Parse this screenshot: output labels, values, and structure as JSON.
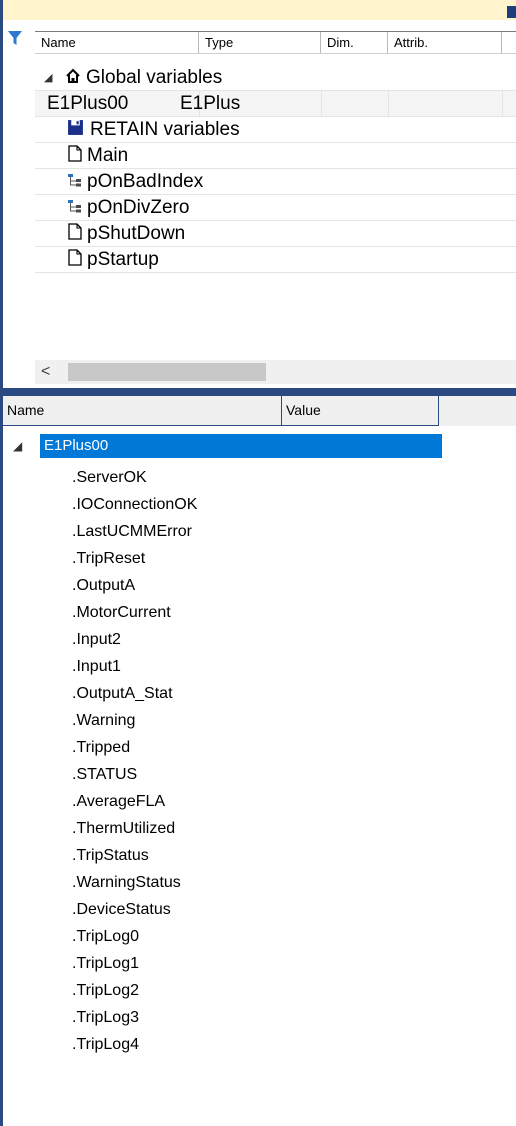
{
  "upper_pane": {
    "columns": [
      "Name",
      "Type",
      "Dim.",
      "Attrib."
    ],
    "rows": [
      {
        "kind": "group",
        "label": "Global variables",
        "icon": "home-icon",
        "expander": "◢"
      },
      {
        "kind": "var",
        "name": "E1Plus00",
        "type": "E1Plus"
      },
      {
        "kind": "item",
        "label": "RETAIN variables",
        "icon": "floppy-disk-icon"
      },
      {
        "kind": "item",
        "label": "Main",
        "icon": "document-icon"
      },
      {
        "kind": "item",
        "label": "pOnBadIndex",
        "icon": "hierarchy-icon"
      },
      {
        "kind": "item",
        "label": "pOnDivZero",
        "icon": "hierarchy-icon"
      },
      {
        "kind": "item",
        "label": "pShutDown",
        "icon": "document-icon"
      },
      {
        "kind": "item",
        "label": "pStartup",
        "icon": "document-icon"
      }
    ],
    "scroll_left_glyph": "<"
  },
  "lower_pane": {
    "columns": [
      "Name",
      "Value"
    ],
    "root": {
      "label": "E1Plus00",
      "expander": "◢"
    },
    "children": [
      ".ServerOK",
      ".IOConnectionOK",
      ".LastUCMMError",
      ".TripReset",
      ".OutputA",
      ".MotorCurrent",
      ".Input2",
      ".Input1",
      ".OutputA_Stat",
      ".Warning",
      ".Tripped",
      ".STATUS",
      ".AverageFLA",
      ".ThermUtilized",
      ".TripStatus",
      ".WarningStatus",
      ".DeviceStatus",
      ".TripLog0",
      ".TripLog1",
      ".TripLog2",
      ".TripLog3",
      ".TripLog4"
    ]
  },
  "colors": {
    "selection": "#0078d7",
    "splitter": "#2b4a84",
    "top_strip": "#fff4cc",
    "filter_icon": "#2e78d2"
  }
}
